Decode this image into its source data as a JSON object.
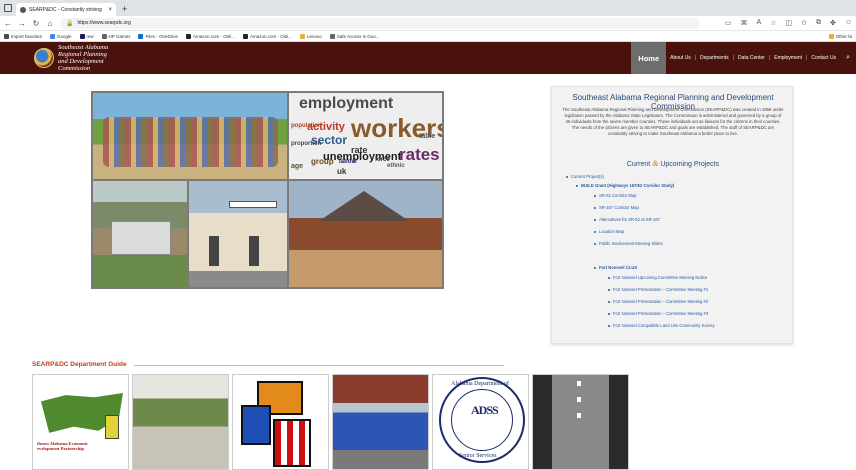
{
  "browser": {
    "tab_title": "SEARP&DC - Constantly striving",
    "tab_close": "×",
    "new_tab": "+",
    "url": "https://www.searpdc.org",
    "bookmarks": [
      {
        "label": "Import favorites",
        "color": "#4a4a4a"
      },
      {
        "label": "Google",
        "color": "#4285f4"
      },
      {
        "label": "mw",
        "color": "#1a1a5a"
      },
      {
        "label": "HP Games",
        "color": "#666"
      },
      {
        "label": "Files - OneDrive",
        "color": "#0a6ed1"
      },
      {
        "label": "Amazon.com - Onli...",
        "color": "#222"
      },
      {
        "label": "Amazon.com - Onli...",
        "color": "#222"
      },
      {
        "label": "Lenovo",
        "color": "#e2b13c"
      },
      {
        "label": "Safe Access is Goo...",
        "color": "#666"
      }
    ],
    "other_favorites": "Other fa"
  },
  "site": {
    "org_name_line1": "Southeast Alabama",
    "org_name_line2": "Regional Planning",
    "org_name_line3": "and Development",
    "org_name_line4": "Commission",
    "nav": [
      "Home",
      "About Us",
      "Departments",
      "Data Center",
      "Employment",
      "Contact Us"
    ],
    "search_icon": "⌕"
  },
  "collage": {
    "words": [
      "employment",
      "workers",
      "activity",
      "sector",
      "unemployment",
      "rates",
      "group",
      "rate",
      "table",
      "population",
      "proportion",
      "force",
      "labour",
      "ethnic",
      "age",
      "uk"
    ]
  },
  "panel": {
    "title": "Southeast Alabama Regional Planning and Development Commission",
    "description": "The Southeast Alabama Regional Planning and Development Commission (SEARP&DC) was created in 1969 under legislation passed by the Alabama State Legislature. The Commission is administered and governed by a group of 26 individuals from the seven member counties. These individuals act as liaisons for the citizens in their counties. The needs of the citizens are given to SEARP&DC and goals are established. The staff of SEARP&DC are constantly striving to make Southeast Alabama a better place to live.",
    "projects_heading_1": "Current",
    "projects_heading_amp": "&",
    "projects_heading_2": "Upcoming Projects",
    "current_projects": "Current Project(s)",
    "build_grant": "BUILD Grant (Highways 167/52 Corridor Study)",
    "build_items": [
      "SR-52 Corridor Map",
      "SR-167 Corridor Map",
      "Alternatives for SR-52 at SR-167",
      "Location Map",
      "Public Involvement Meeting Slides"
    ],
    "fort_novosel": "Fort Novosel CLUS",
    "fort_items": [
      "Fort Novosel Upcoming Committee Meeting Notice",
      "Fort Novosel Presentation – Committee Meeting #1",
      "Fort Novosel Presentation – Committee Meeting #2",
      "Fort Novosel Presentation – Committee Meeting #3",
      "Fort Novosel Compatible Land Use Community Survey"
    ]
  },
  "dept_guide": {
    "heading": "SEARP&DC Department Guide",
    "card1_caption": "theast Alabama Economic evelopment Partnership",
    "card5_top": "Alabama Department of",
    "card5_center": "ADSS",
    "card5_bottom": "Senior Services"
  }
}
